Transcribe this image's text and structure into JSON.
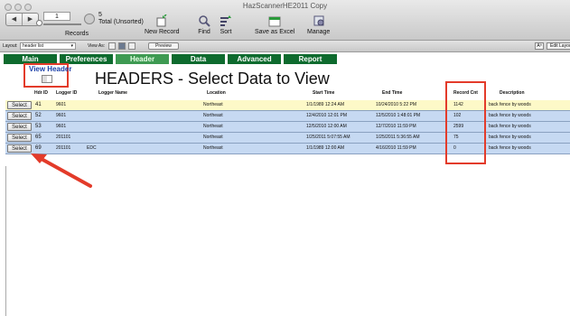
{
  "window": {
    "title": "HazScannerHE2011 Copy"
  },
  "toolbar": {
    "record_current": "1",
    "total_count": "5",
    "total_label": "Total (Unsorted)",
    "records_label": "Records",
    "buttons": {
      "new_record": "New Record",
      "find": "Find",
      "sort": "Sort",
      "save_excel": "Save as Excel",
      "manage": "Manage"
    }
  },
  "layout_bar": {
    "layout_label": "Layout:",
    "layout_value": "header list",
    "view_as_label": "View As:",
    "preview_label": "Preview",
    "aa_label": "Aª",
    "edit_layout_label": "Edit Layout"
  },
  "nav": {
    "tabs": [
      "Main",
      "Preferences",
      "Header",
      "Data",
      "Advanced",
      "Report"
    ],
    "active": "Header"
  },
  "content": {
    "view_header_label": "View Header",
    "page_title": "HEADERS - Select Data to View",
    "columns": [
      "Hdr ID",
      "Logger ID",
      "Logger Name",
      "Location",
      "Start Time",
      "End Time",
      "Record Cnt",
      "Description"
    ],
    "select_label": "Select",
    "rows": [
      {
        "hdr_id": "41",
        "logger_id": "9601",
        "logger_name": "",
        "location": "Northeast",
        "start": "1/1/1989 12:24 AM",
        "end": "10/24/2010 5:22 PM",
        "count": "1142",
        "desc": "back fence by woods"
      },
      {
        "hdr_id": "52",
        "logger_id": "9601",
        "logger_name": "",
        "location": "Northeast",
        "start": "12/4/2010 12:01 PM",
        "end": "12/5/2010 1:48:01 PM",
        "count": "102",
        "desc": "back fence by woods"
      },
      {
        "hdr_id": "53",
        "logger_id": "9601",
        "logger_name": "",
        "location": "Northeast",
        "start": "12/5/2010 12:00 AM",
        "end": "12/7/2010 11:59 PM",
        "count": "2599",
        "desc": "back fence by woods"
      },
      {
        "hdr_id": "65",
        "logger_id": "201101",
        "logger_name": "",
        "location": "Northeast",
        "start": "1/25/2011 5:07:55 AM",
        "end": "1/25/2011 5:36:55 AM",
        "count": "75",
        "desc": "back fence by woods"
      },
      {
        "hdr_id": "69",
        "logger_id": "201101",
        "logger_name": "EDC",
        "location": "Northeast",
        "start": "1/1/1989 12:00 AM",
        "end": "4/16/2010 11:59 PM",
        "count": "0",
        "desc": "back fence by woods"
      }
    ]
  },
  "colors": {
    "nav_green": "#0e6b2e",
    "nav_active": "#3e9a52",
    "highlight_red": "#e33b2a",
    "row_yellow": "#fdf9c8",
    "row_blue": "#c6d9f2",
    "view_header_blue": "#1a3fa8"
  }
}
